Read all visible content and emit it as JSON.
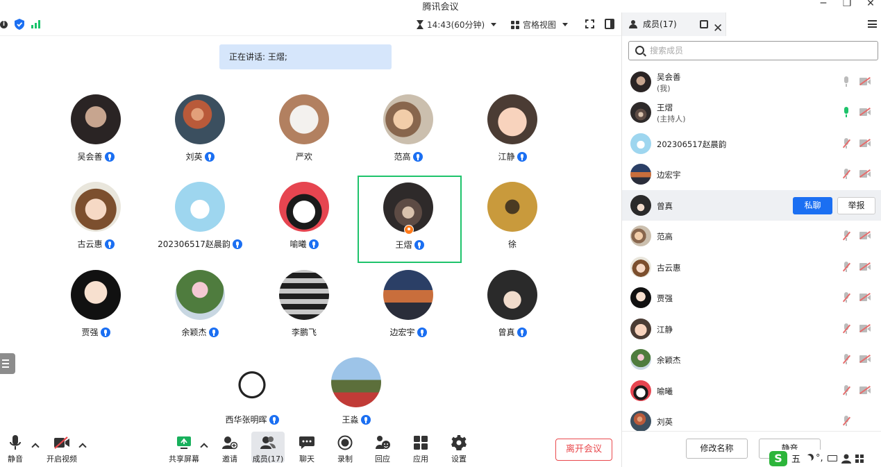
{
  "window": {
    "title": "腾讯会议",
    "controls": [
      "─",
      "❐",
      "✕"
    ]
  },
  "topbar": {
    "timer": "14:43(60分钟)",
    "view_mode": "宫格视图"
  },
  "speaking_banner": "正在讲话: 王熠;",
  "participants": [
    {
      "name": "吴会善",
      "mic": true
    },
    {
      "name": "刘英",
      "mic": true
    },
    {
      "name": "严欢",
      "mic": false
    },
    {
      "name": "范高",
      "mic": true
    },
    {
      "name": "江静",
      "mic": true
    },
    {
      "name": "古云惠",
      "mic": true
    },
    {
      "name": "202306517赵晨韵",
      "mic": true
    },
    {
      "name": "喻曦",
      "mic": true
    },
    {
      "name": "王熠",
      "mic": true
    },
    {
      "name": "徐",
      "mic": false
    },
    {
      "name": "贾强",
      "mic": true
    },
    {
      "name": "余颖杰",
      "mic": true
    },
    {
      "name": "李鹏飞",
      "mic": false
    },
    {
      "name": "边宏宇",
      "mic": true
    },
    {
      "name": "曾真",
      "mic": true
    },
    {
      "name": "西华张明晖",
      "mic": true
    },
    {
      "name": "王淼",
      "mic": true
    }
  ],
  "toolbar": {
    "mute": "静音",
    "video": "开启视频",
    "share": "共享屏幕",
    "invite": "邀请",
    "members": "成员(17)",
    "chat": "聊天",
    "record": "录制",
    "react": "回应",
    "apps": "应用",
    "settings": "设置",
    "leave": "离开会议"
  },
  "panel": {
    "tab": "成员(17)",
    "search_placeholder": "搜索成员",
    "members": [
      {
        "name": "吴会善",
        "role": "(我)",
        "mic": "off"
      },
      {
        "name": "王熠",
        "role": "(主持人)",
        "mic": "on"
      },
      {
        "name": "202306517赵晨韵",
        "role": "",
        "mic": "muted"
      },
      {
        "name": "边宏宇",
        "role": "",
        "mic": "muted"
      },
      {
        "name": "曾真",
        "role": "",
        "mic": "hover"
      },
      {
        "name": "范高",
        "role": "",
        "mic": "muted"
      },
      {
        "name": "古云惠",
        "role": "",
        "mic": "muted"
      },
      {
        "name": "贾强",
        "role": "",
        "mic": "muted"
      },
      {
        "name": "江静",
        "role": "",
        "mic": "muted"
      },
      {
        "name": "余颖杰",
        "role": "",
        "mic": "muted"
      },
      {
        "name": "喻曦",
        "role": "",
        "mic": "muted"
      },
      {
        "name": "刘英",
        "role": "",
        "mic": "muted"
      }
    ],
    "private_chat": "私聊",
    "report": "举报",
    "rename": "修改名称",
    "mute": "静音"
  },
  "ime": {
    "logo": "S",
    "mode": "五",
    "punct": "°,"
  }
}
